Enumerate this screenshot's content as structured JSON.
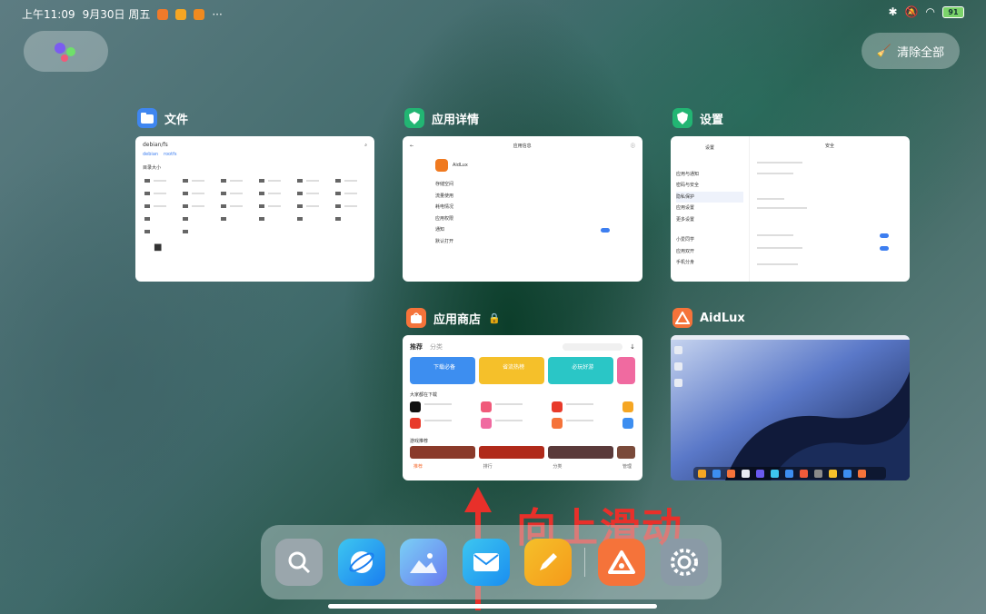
{
  "status_bar": {
    "time": "上午11:09",
    "date": "9月30日 周五",
    "more": "···",
    "battery": "91"
  },
  "clear_all_label": "清除全部",
  "cards": {
    "files": {
      "title": "文件",
      "thumb_title": "debian/fs",
      "path_a": "debian",
      "path_b": "rootfs",
      "section": "目录大小"
    },
    "app_details": {
      "title": "应用详情",
      "thumb_title": "应用信息",
      "app_name": "AidLux",
      "rows": [
        "存储空间",
        "流量使用",
        "耗电情况",
        "应用权限",
        "通知",
        "默认打开"
      ]
    },
    "settings": {
      "title": "设置",
      "thumb_left_title": "设置",
      "thumb_right_title": "安全",
      "menu": [
        "应用与通知",
        "密码与安全",
        "隐私保护",
        "应用设置",
        "更多设置",
        "小爱同学",
        "应用双开",
        "手机分身"
      ]
    },
    "app_store": {
      "title": "应用商店",
      "tab_recommend": "推荐",
      "tab_category": "分类",
      "banners": [
        "下载必备",
        "省流热榜",
        "必玩好游"
      ],
      "section_hot": "大家都在下载",
      "section_games": "游戏推荐",
      "nav": [
        "推荐",
        "排行",
        "分类",
        "管理"
      ]
    },
    "aidlux": {
      "title": "AidLux"
    }
  },
  "annotation": "向上滑动",
  "dock": [
    "search-app",
    "browser-app",
    "gallery-app",
    "mail-app",
    "notes-app",
    "aidlux-app",
    "settings-app"
  ]
}
